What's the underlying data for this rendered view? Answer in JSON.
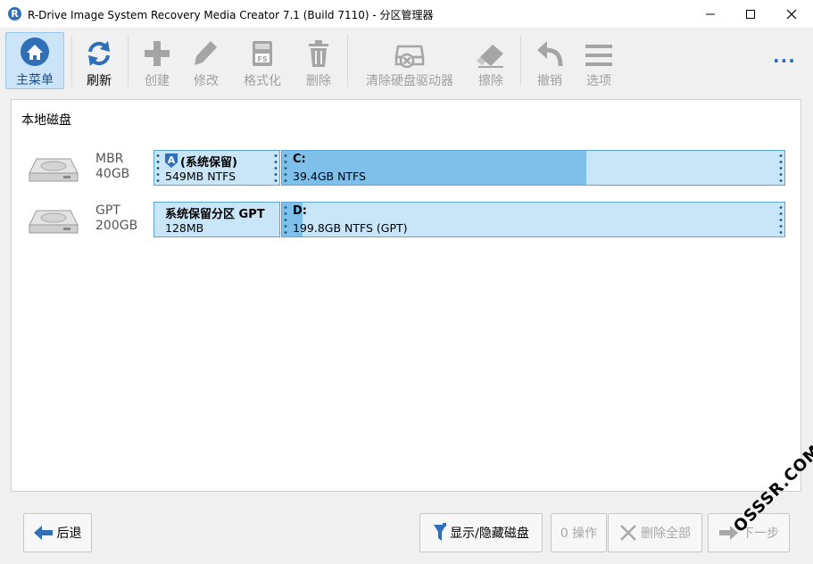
{
  "window": {
    "title": "R-Drive Image System Recovery Media Creator 7.1 (Build 7110) - 分区管理器",
    "logo_letter": "R"
  },
  "toolbar": {
    "items": [
      {
        "label": "主菜单",
        "icon": "home-icon",
        "state": "active"
      },
      {
        "label": "刷新",
        "icon": "refresh-icon",
        "state": "enabled"
      },
      {
        "label": "创建",
        "icon": "plus-icon",
        "state": "disabled"
      },
      {
        "label": "修改",
        "icon": "pencil-icon",
        "state": "disabled"
      },
      {
        "label": "格式化",
        "icon": "format-fs-icon",
        "state": "disabled"
      },
      {
        "label": "删除",
        "icon": "trash-icon",
        "state": "disabled"
      },
      {
        "label": "清除硬盘驱动器",
        "icon": "wipe-drive-icon",
        "state": "disabled"
      },
      {
        "label": "擦除",
        "icon": "eraser-icon",
        "state": "disabled"
      },
      {
        "label": "撤销",
        "icon": "undo-icon",
        "state": "disabled"
      },
      {
        "label": "选项",
        "icon": "menu-lines-icon",
        "state": "disabled"
      }
    ],
    "more": "..."
  },
  "main": {
    "section_title": "本地磁盘",
    "disks": [
      {
        "type": "MBR",
        "size": "40GB",
        "partitions": [
          {
            "name": "(系统保留)",
            "info": "549MB NTFS",
            "has_flag": true,
            "flag_letter": "A",
            "used": 0
          },
          {
            "name": "C:",
            "info": "39.4GB NTFS",
            "has_flag": false,
            "used": 0.605
          }
        ]
      },
      {
        "type": "GPT",
        "size": "200GB",
        "partitions": [
          {
            "name": "系统保留分区 GPT",
            "info": "128MB",
            "has_flag": false,
            "used": 0
          },
          {
            "name": "D:",
            "info": "199.8GB NTFS (GPT)",
            "has_flag": false,
            "used": 0.04
          }
        ]
      }
    ]
  },
  "bottom": {
    "back_label": "后退",
    "show_hide_label": "显示/隐藏磁盘",
    "ops_label": "0 操作",
    "delete_all_label": "删除全部",
    "next_label": "下一步"
  },
  "watermark": "OSSSR.COM",
  "colors": {
    "accent": "#2e6fb8",
    "partition_bg": "#c8e6f8",
    "partition_used": "#7ec0ea",
    "partition_border": "#5aa5d9",
    "active_tool_bg": "#cce4f7"
  }
}
